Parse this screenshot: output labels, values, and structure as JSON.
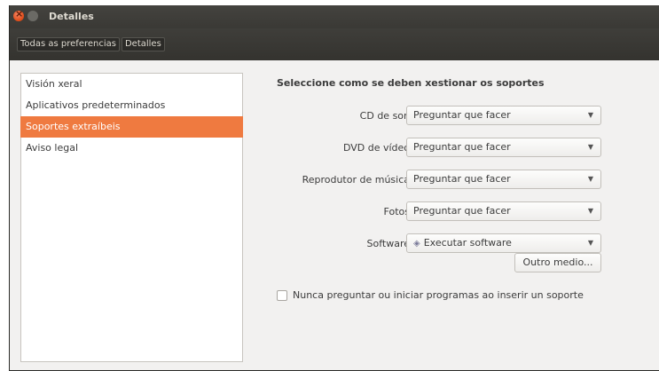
{
  "window": {
    "title": "Detalles"
  },
  "breadcrumb": {
    "items": [
      "Todas as preferencias",
      "Detalles"
    ]
  },
  "sidebar": {
    "items": [
      {
        "label": "Visión xeral",
        "active": false
      },
      {
        "label": "Aplicativos predeterminados",
        "active": false
      },
      {
        "label": "Soportes extraíbeis",
        "active": true
      },
      {
        "label": "Aviso legal",
        "active": false
      }
    ]
  },
  "main": {
    "heading": "Seleccione como se deben xestionar os soportes",
    "rows": [
      {
        "label": "CD de son",
        "value": "Preguntar que facer"
      },
      {
        "label": "DVD de vídeo",
        "value": "Preguntar que facer"
      },
      {
        "label": "Reprodutor de música",
        "value": "Preguntar que facer"
      },
      {
        "label": "Fotos",
        "value": "Preguntar que facer"
      },
      {
        "label": "Software",
        "value": "Executar software",
        "icon": "software-diamond-icon"
      }
    ],
    "other_button": "Outro medio...",
    "checkbox": {
      "label": "Nunca preguntar ou iniciar programas ao inserir un soporte",
      "checked": false
    }
  },
  "colors": {
    "accent": "#ef7a40",
    "titlebar": "#3c3b37"
  }
}
